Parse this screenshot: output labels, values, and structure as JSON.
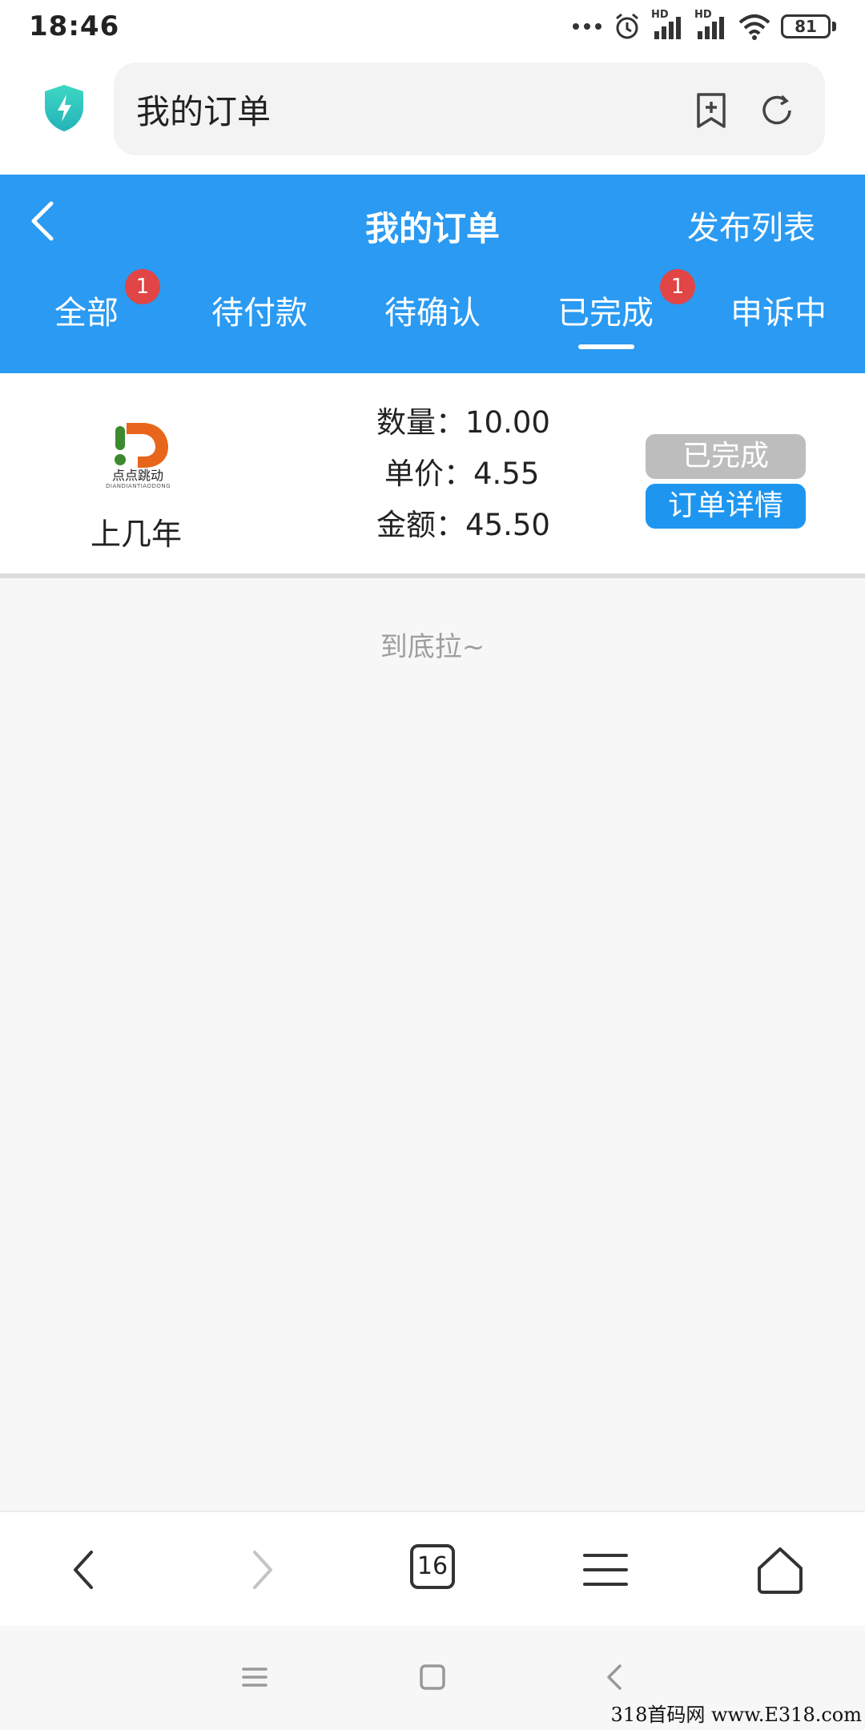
{
  "status_bar": {
    "time": "18:46",
    "network_label": "HD",
    "battery": "81"
  },
  "browser": {
    "url_text": "我的订单",
    "tab_count": "16"
  },
  "header": {
    "title": "我的订单",
    "action": "发布列表"
  },
  "tabs": [
    {
      "label": "全部",
      "badge": "1"
    },
    {
      "label": "待付款"
    },
    {
      "label": "待确认"
    },
    {
      "label": "已完成",
      "badge": "1",
      "active": true
    },
    {
      "label": "申诉中"
    }
  ],
  "order": {
    "logo_text": "点点跳动",
    "logo_subtext": "DIANDIANTIAODONG",
    "product_name": "上几年",
    "quantity_line": "数量：10.00",
    "price_line": "单价：4.55",
    "amount_line": "金额：45.50",
    "status": "已完成",
    "detail_button": "订单详情"
  },
  "list_end_text": "到底拉~",
  "watermark": "318首码网 www.E318.com",
  "colors": {
    "accent": "#2a9af2",
    "badge": "#e14545",
    "status_gray": "#bdbdbd",
    "button_blue": "#1e96f0"
  }
}
